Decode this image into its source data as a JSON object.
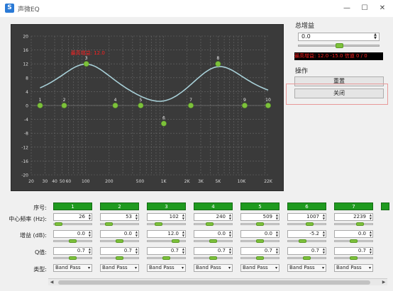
{
  "window": {
    "title": "声微EQ",
    "app_icon_letter": "S",
    "minimize": "—",
    "maximize": "☐",
    "close": "✕"
  },
  "chart_data": {
    "type": "line",
    "title": "",
    "annotation": "最高增益: 12.0",
    "y_ticks": [
      20,
      16,
      12,
      8,
      4,
      0,
      -4,
      -8,
      -12,
      -16,
      -20
    ],
    "x_ticks": [
      "20",
      "30",
      "40",
      "50",
      "60",
      "100",
      "200",
      "500",
      "1K",
      "2K",
      "3K",
      "5K",
      "10K",
      "22K"
    ],
    "x_tick_freqs": [
      20,
      30,
      40,
      50,
      60,
      100,
      200,
      500,
      1000,
      2000,
      3000,
      5000,
      10000,
      22000
    ],
    "ylim": [
      -20,
      20
    ],
    "xlim": [
      20,
      22000
    ],
    "x_scale": "log",
    "grid": true,
    "points": [
      {
        "label": "1",
        "freq": 26,
        "gain": 0.0
      },
      {
        "label": "2",
        "freq": 53,
        "gain": 0.0
      },
      {
        "label": "3",
        "freq": 102,
        "gain": 12.0
      },
      {
        "label": "4",
        "freq": 240,
        "gain": 0.0
      },
      {
        "label": "5",
        "freq": 509,
        "gain": 0.0
      },
      {
        "label": "6",
        "freq": 1007,
        "gain": -5.2
      },
      {
        "label": "7",
        "freq": 2239,
        "gain": 0.0
      },
      {
        "label": "8",
        "freq": 5000,
        "gain": 12.0
      },
      {
        "label": "9",
        "freq": 11000,
        "gain": 0.0
      },
      {
        "label": "10",
        "freq": 22000,
        "gain": 0.0
      }
    ],
    "colors": {
      "background": "#3a3a3a",
      "curve": "#a8d0d8",
      "point": "#7dc13b",
      "annotation": "#ff2020",
      "grid": "#6a6a6a",
      "axis_text": "#dddddd"
    }
  },
  "side": {
    "total_gain_label": "总增益",
    "total_gain_value": "0.0",
    "total_gain_level": 0.5,
    "status_text": "最高增益: 12.0  -15.0  信道 0 / 0",
    "operation_label": "操作",
    "reset_button": "重置",
    "close_button": "关闭"
  },
  "rows": {
    "index_label": "序号:",
    "freq_label": "中心频率 (Hz):",
    "gain_label": "增益 (dB):",
    "q_label": "Q值:",
    "type_label": "类型:"
  },
  "bands": [
    {
      "id": "1",
      "freq": "26",
      "gain": "0.0",
      "q": "0.7",
      "type": "Band Pass",
      "freq_level": 0.05,
      "gain_level": 0.5,
      "q_level": 0.5
    },
    {
      "id": "2",
      "freq": "53",
      "gain": "0.0",
      "q": "0.7",
      "type": "Band Pass",
      "freq_level": 0.15,
      "gain_level": 0.5,
      "q_level": 0.5
    },
    {
      "id": "3",
      "freq": "102",
      "gain": "12.0",
      "q": "0.7",
      "type": "Band Pass",
      "freq_level": 0.25,
      "gain_level": 0.8,
      "q_level": 0.5
    },
    {
      "id": "4",
      "freq": "240",
      "gain": "0.0",
      "q": "0.7",
      "type": "Band Pass",
      "freq_level": 0.38,
      "gain_level": 0.5,
      "q_level": 0.5
    },
    {
      "id": "5",
      "freq": "509",
      "gain": "0.0",
      "q": "0.7",
      "type": "Band Pass",
      "freq_level": 0.5,
      "gain_level": 0.5,
      "q_level": 0.5
    },
    {
      "id": "6",
      "freq": "1007",
      "gain": "-5.2",
      "q": "0.7",
      "type": "Band Pass",
      "freq_level": 0.6,
      "gain_level": 0.37,
      "q_level": 0.5
    },
    {
      "id": "7",
      "freq": "2239",
      "gain": "0.0",
      "q": "0.7",
      "type": "Band Pass",
      "freq_level": 0.7,
      "gain_level": 0.5,
      "q_level": 0.5
    }
  ],
  "scroll": {
    "left": "◀",
    "right": "▶"
  }
}
